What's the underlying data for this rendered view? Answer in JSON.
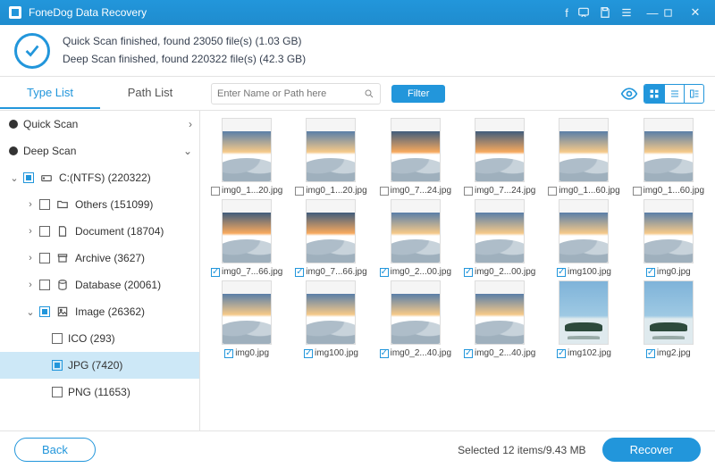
{
  "title": "FoneDog Data Recovery",
  "status": {
    "line1": "Quick Scan finished, found 23050 file(s) (1.03 GB)",
    "line2": "Deep Scan finished, found 220322 file(s) (42.3 GB)"
  },
  "tabs": {
    "type": "Type List",
    "path": "Path List"
  },
  "search": {
    "placeholder": "Enter Name or Path here"
  },
  "filter": "Filter",
  "sidebar": {
    "quick": "Quick Scan",
    "deep": "Deep Scan",
    "drive": "C:(NTFS) (220322)",
    "others": "Others (151099)",
    "document": "Document (18704)",
    "archive": "Archive (3627)",
    "database": "Database (20061)",
    "image": "Image (26362)",
    "ico": "ICO (293)",
    "jpg": "JPG (7420)",
    "png": "PNG (11653)"
  },
  "thumbs": [
    {
      "name": "img0_1...20.jpg",
      "checked": false,
      "v": 1
    },
    {
      "name": "img0_1...20.jpg",
      "checked": false,
      "v": 1
    },
    {
      "name": "img0_7...24.jpg",
      "checked": false,
      "v": 2
    },
    {
      "name": "img0_7...24.jpg",
      "checked": false,
      "v": 2
    },
    {
      "name": "img0_1...60.jpg",
      "checked": false,
      "v": 1
    },
    {
      "name": "img0_1...60.jpg",
      "checked": false,
      "v": 1
    },
    {
      "name": "img0_7...66.jpg",
      "checked": true,
      "v": 2
    },
    {
      "name": "img0_7...66.jpg",
      "checked": true,
      "v": 2
    },
    {
      "name": "img0_2...00.jpg",
      "checked": true,
      "v": 1
    },
    {
      "name": "img0_2...00.jpg",
      "checked": true,
      "v": 1
    },
    {
      "name": "img100.jpg",
      "checked": true,
      "v": 1
    },
    {
      "name": "img0.jpg",
      "checked": true,
      "v": 1
    },
    {
      "name": "img0.jpg",
      "checked": true,
      "v": 1
    },
    {
      "name": "img100.jpg",
      "checked": true,
      "v": 1
    },
    {
      "name": "img0_2...40.jpg",
      "checked": true,
      "v": 1
    },
    {
      "name": "img0_2...40.jpg",
      "checked": true,
      "v": 1
    },
    {
      "name": "img102.jpg",
      "checked": true,
      "v": 3
    },
    {
      "name": "img2.jpg",
      "checked": true,
      "v": 3
    }
  ],
  "footer": {
    "back": "Back",
    "selected": "Selected 12 items/9.43 MB",
    "recover": "Recover"
  }
}
